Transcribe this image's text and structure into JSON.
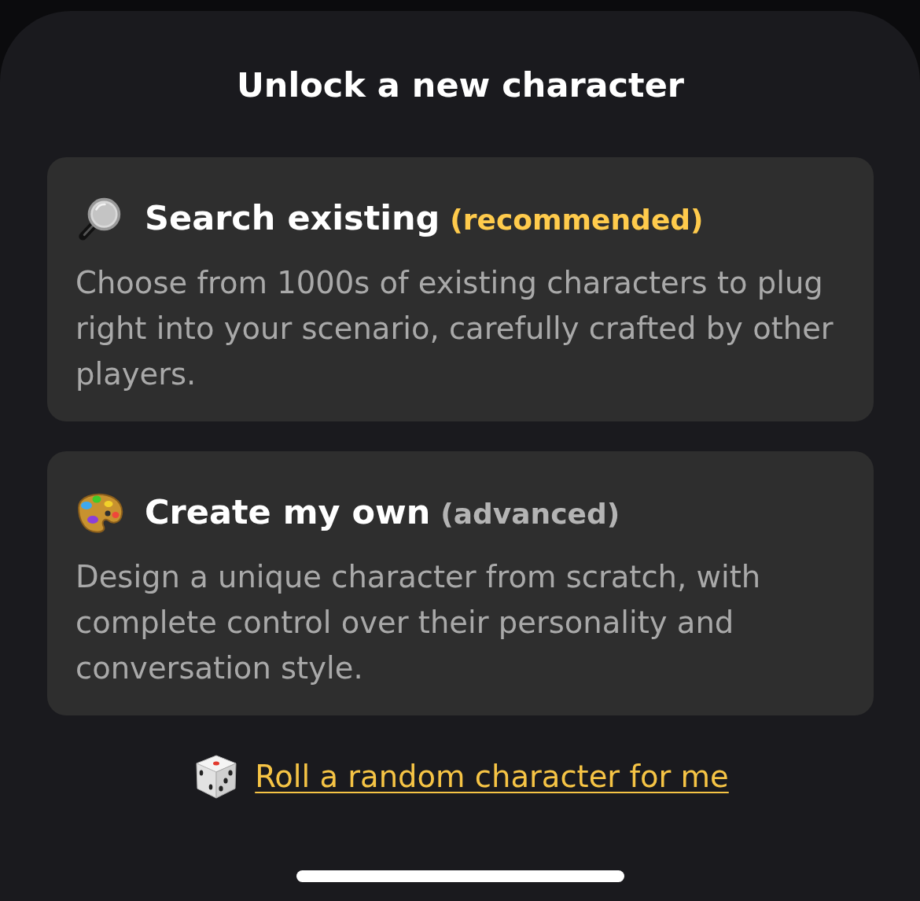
{
  "sheet": {
    "title": "Unlock a new character"
  },
  "options": [
    {
      "kind": "search",
      "title": "Search existing",
      "tag": {
        "text": "(recommended)",
        "color": "#ffcb4c"
      },
      "description": "Choose from 1000s of existing characters to plug right into your scenario, carefully crafted by other players."
    },
    {
      "kind": "create",
      "title": "Create my own",
      "tag": {
        "text": "(advanced)",
        "color": "#b4b4b4"
      },
      "description": "Design a unique character from scratch, with complete control over their personality and conversation style."
    }
  ],
  "random_link": {
    "label": "Roll a random character for me"
  }
}
